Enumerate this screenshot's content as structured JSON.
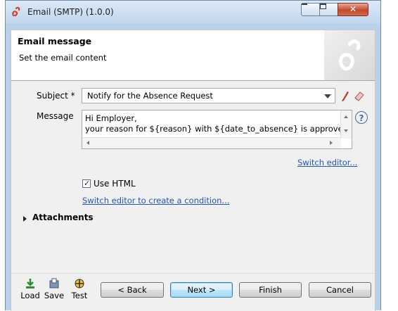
{
  "window": {
    "title": "Email (SMTP) (1.0.0)"
  },
  "banner": {
    "title": "Email message",
    "subtitle": "Set the email content"
  },
  "form": {
    "subject_label": "Subject *",
    "subject_value": "Notify for the Absence Request",
    "message_label": "Message",
    "message_lines": [
      "Hi Employer,",
      "your reason for ${reason} with ${date_to_absence} is approved."
    ],
    "switch_editor_link": "Switch editor...",
    "use_html_label": "Use HTML",
    "use_html_checked": true,
    "switch_condition_link": "Switch editor to create a condition...",
    "attachments_label": "Attachments"
  },
  "toolbar": {
    "load_label": "Load",
    "save_label": "Save",
    "test_label": "Test"
  },
  "buttons": {
    "back": "< Back",
    "next": "Next >",
    "finish": "Finish",
    "cancel": "Cancel"
  },
  "colors": {
    "link": "#2356b7",
    "accent": "#3c7fb1",
    "close": "#c24a2e"
  },
  "icons": [
    "bonita-logo-icon",
    "minimize-icon",
    "maximize-icon",
    "close-icon",
    "pencil-icon",
    "eraser-icon",
    "help-icon",
    "load-icon",
    "save-icon",
    "test-icon"
  ]
}
